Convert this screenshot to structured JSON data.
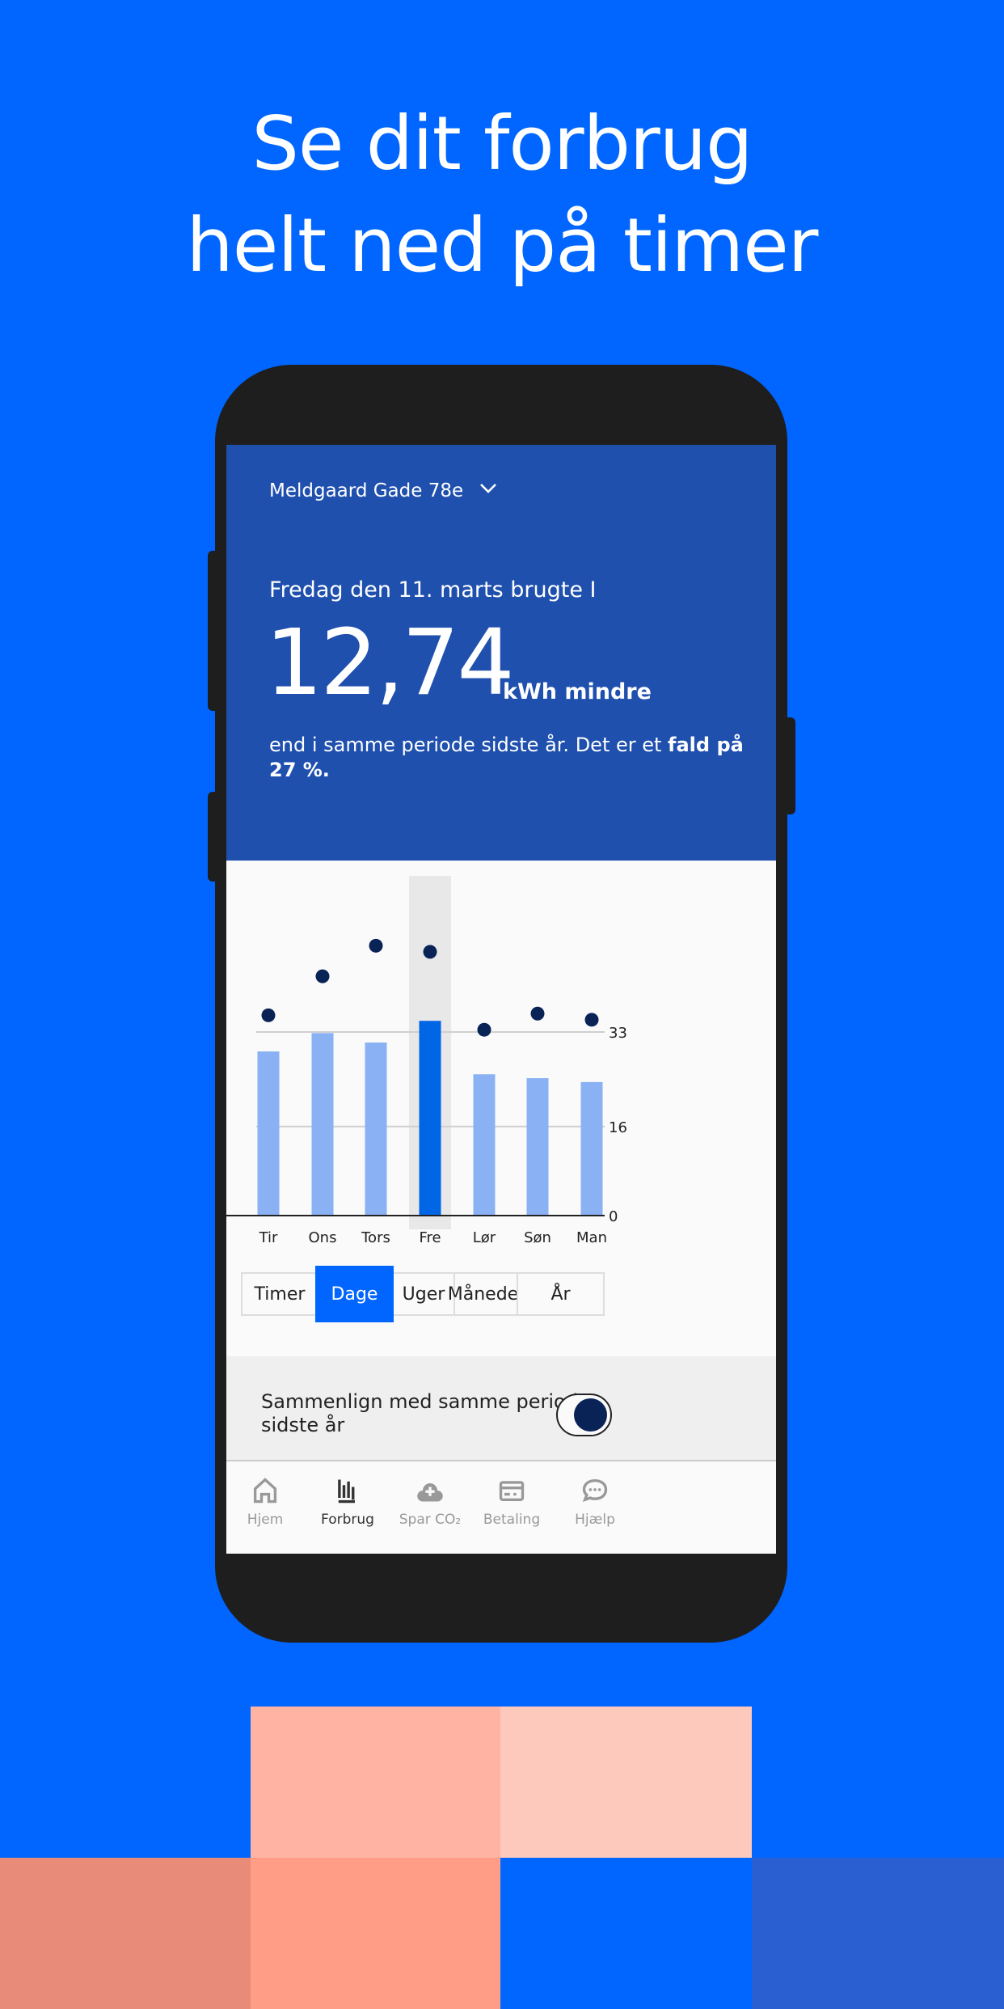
{
  "headline": {
    "line1": "Se dit forbrug",
    "line2": "helt ned på timer"
  },
  "header": {
    "address": "Meldgaard Gade 78e",
    "address_icon": "chevron-down-icon",
    "intro": "Fredag den 11. marts brugte I",
    "value": "12,74",
    "unit": "kWh mindre",
    "text_plain": "end i samme periode sidste år. Det er et ",
    "text_bold": "fald på 27 %."
  },
  "chart_data": {
    "type": "bar",
    "categories": [
      "Tir",
      "Ons",
      "Tors",
      "Fre",
      "Lør",
      "Søn",
      "Man"
    ],
    "series": [
      {
        "values": [
          29.5,
          32.8,
          31.1,
          35,
          25.4,
          24.7,
          24
        ]
      },
      {
        "type": "scatter",
        "values": [
          36,
          43,
          48.5,
          47.4,
          33.4,
          36.3,
          35.2
        ]
      }
    ],
    "partial_previous_bar": 28.8,
    "highlighted": "Fre",
    "yticks": [
      0,
      16,
      33
    ],
    "ylim": [
      0,
      50
    ],
    "grid": true,
    "colors": {
      "bar": "#8ab1f4",
      "highlight_bar": "#0066e6",
      "dot": "#0a2357",
      "highlight_bg": "#e8e8e8"
    }
  },
  "segments": [
    {
      "label": "Timer"
    },
    {
      "label": "Dage",
      "active": true
    },
    {
      "label": "Uger"
    },
    {
      "label": "Måneder"
    },
    {
      "label": "År"
    }
  ],
  "compare": {
    "label": "Sammenlign med samme periode sidste år",
    "toggle_on": true
  },
  "tabs": [
    {
      "label": "Hjem",
      "icon": "home-icon"
    },
    {
      "label": "Forbrug",
      "icon": "bar-chart-icon",
      "active": true
    },
    {
      "label": "Spar CO₂",
      "icon": "cloud-plus-icon"
    },
    {
      "label": "Betaling",
      "icon": "credit-card-icon"
    },
    {
      "label": "Hjælp",
      "icon": "chat-bubble-icon"
    }
  ],
  "colors": {
    "background": "#0066ff",
    "header": "#1f50ae",
    "blocks": [
      "#ffb3a3",
      "#fdc9bd",
      "#e88c79",
      "#ff9d87",
      "#0066ff",
      "#2a5fd1"
    ]
  }
}
